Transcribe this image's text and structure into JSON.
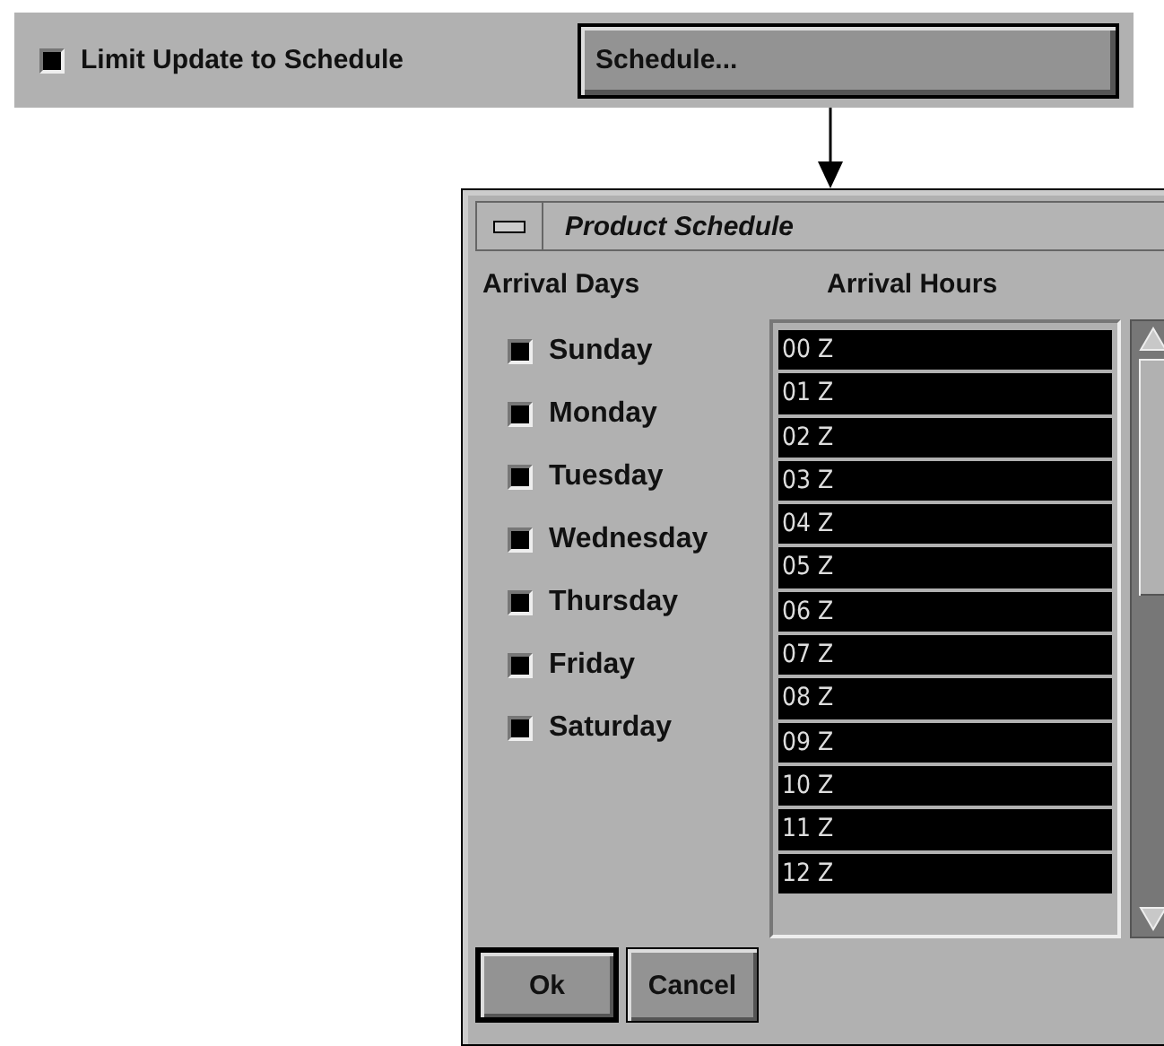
{
  "options_bar": {
    "limit_checkbox": {
      "label": "Limit Update to Schedule",
      "checked": true
    },
    "schedule_button": "Schedule..."
  },
  "dialog": {
    "title": "Product Schedule",
    "days_heading": "Arrival Days",
    "hours_heading": "Arrival Hours",
    "days": [
      {
        "label": "Sunday",
        "checked": true
      },
      {
        "label": "Monday",
        "checked": true
      },
      {
        "label": "Tuesday",
        "checked": true
      },
      {
        "label": "Wednesday",
        "checked": true
      },
      {
        "label": "Thursday",
        "checked": true
      },
      {
        "label": "Friday",
        "checked": true
      },
      {
        "label": "Saturday",
        "checked": true
      }
    ],
    "hours": [
      {
        "label": "00 Z",
        "selected": true
      },
      {
        "label": "01 Z",
        "selected": true
      },
      {
        "label": "02 Z",
        "selected": true
      },
      {
        "label": "03 Z",
        "selected": true
      },
      {
        "label": "04 Z",
        "selected": true
      },
      {
        "label": "05 Z",
        "selected": true
      },
      {
        "label": "06 Z",
        "selected": true
      },
      {
        "label": "07 Z",
        "selected": true
      },
      {
        "label": "08 Z",
        "selected": true
      },
      {
        "label": "09 Z",
        "selected": true
      },
      {
        "label": "10 Z",
        "selected": true
      },
      {
        "label": "11 Z",
        "selected": true
      },
      {
        "label": "12 Z",
        "selected": true
      }
    ],
    "buttons": [
      {
        "label": "Ok",
        "default": true
      },
      {
        "label": "Cancel",
        "default": false
      }
    ]
  }
}
